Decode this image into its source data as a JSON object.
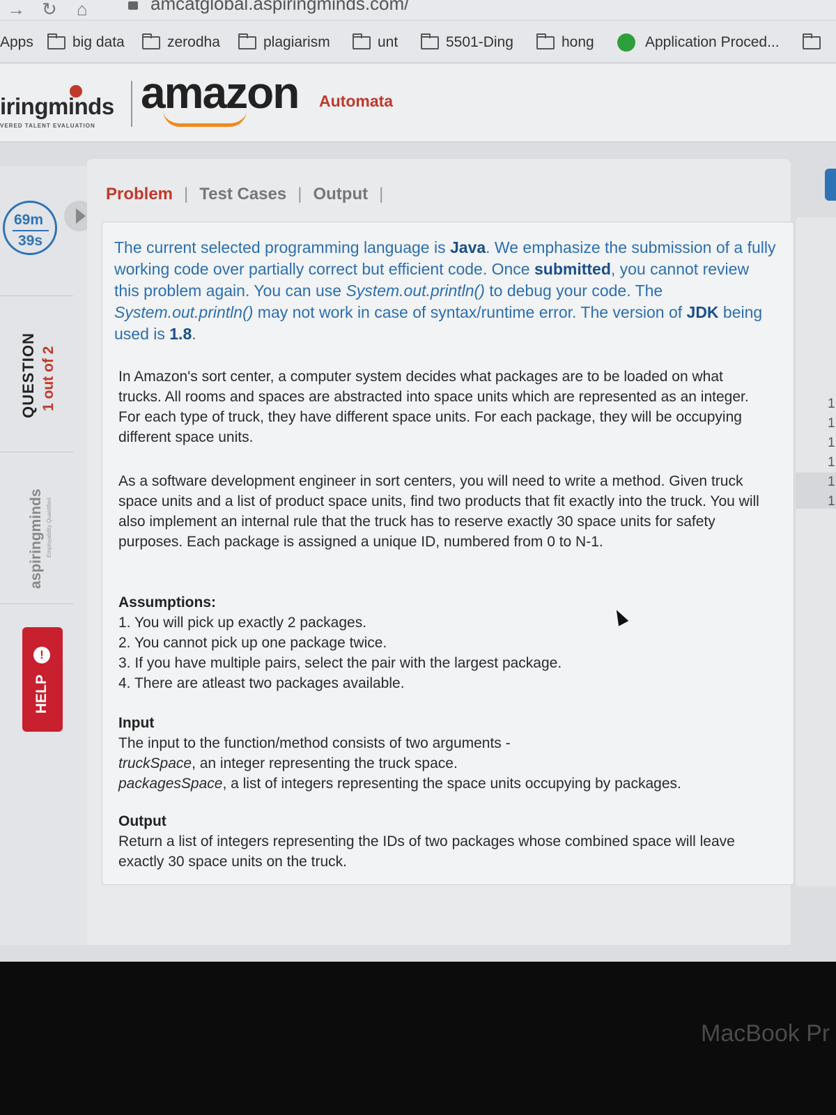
{
  "browser": {
    "url_visible": "amcatglobal.aspiringminds.com/",
    "bookmarks": [
      {
        "label": "Apps",
        "icon": "apps-icon"
      },
      {
        "label": "big data",
        "icon": "folder-icon"
      },
      {
        "label": "zerodha",
        "icon": "folder-icon"
      },
      {
        "label": "plagiarism",
        "icon": "folder-icon"
      },
      {
        "label": "unt",
        "icon": "folder-icon"
      },
      {
        "label": "5501-Ding",
        "icon": "folder-icon"
      },
      {
        "label": "hong",
        "icon": "folder-icon"
      },
      {
        "label": "Application Proced...",
        "icon": "globe-icon"
      }
    ]
  },
  "header": {
    "brand": "iringminds",
    "brand_tagline": "VERED TALENT EVALUATION",
    "amazon_logo": "amazon",
    "section": "Automata"
  },
  "sidebar": {
    "timer_minutes": "69m",
    "timer_seconds": "39s",
    "question_label": "QUESTION",
    "question_count": "1 out of 2",
    "brand_vertical": "aspiringminds",
    "brand_vertical_sub": "Employability Quantified",
    "help_label": "HELP",
    "help_icon": "!"
  },
  "tabs": [
    {
      "label": "Problem",
      "active": true
    },
    {
      "label": "Test Cases",
      "active": false
    },
    {
      "label": "Output",
      "active": false
    }
  ],
  "problem": {
    "intro": {
      "s1": "The current selected programming language is ",
      "lang": "Java",
      "s2": ". We emphasize the submission of a fully working code over partially correct but efficient code. Once ",
      "submitted": "submitted",
      "s3": ", you cannot review this problem again. You can use ",
      "println1": "System.out.println()",
      "s4": " to debug your code. The ",
      "println2": "System.out.println()",
      "s5": " may not work in case of syntax/runtime error. The version of ",
      "jdk": "JDK",
      "s6": " being used is ",
      "version": "1.8",
      "s7": "."
    },
    "paragraph1": "In Amazon's sort center, a computer system decides what packages are to be loaded on what trucks. All rooms and spaces are abstracted into space units which are represented as an integer. For each type of truck, they have different space units. For each package, they will be occupying different space units.",
    "paragraph2": "As a software development engineer in sort centers, you will need to write a method. Given truck space units and a list of product space units, find two products that fit exactly into the truck. You will also implement an internal rule that the truck has to reserve exactly 30 space units for safety purposes. Each package is assigned a unique ID, numbered from 0 to N-1.",
    "assumptions_title": "Assumptions:",
    "assumptions": [
      "1. You will pick up exactly 2 packages.",
      "2. You cannot pick up one package twice.",
      "3. If you have multiple pairs, select the pair with the largest package.",
      "4. There are atleast two packages available."
    ],
    "input_title": "Input",
    "input_line": "The input to the function/method consists of two arguments -",
    "input_arg1_name": "truckSpace",
    "input_arg1_desc": ", an integer representing the truck space.",
    "input_arg2_name": "packagesSpace",
    "input_arg2_desc": ", a list of integers representing the space units occupying by packages.",
    "output_title": "Output",
    "output_text": "Return a list of integers representing the IDs of two packages whose combined space will leave exactly 30 space units on the truck."
  },
  "right_panel": {
    "line_numbers": [
      "1",
      "1",
      "1",
      "1",
      "1",
      "1"
    ]
  },
  "device": {
    "label": "MacBook Pr"
  },
  "colors": {
    "accent_red": "#c0392b",
    "link_blue": "#2b6fb0",
    "help_red": "#c8202e",
    "amazon_orange": "#f08a1c"
  }
}
